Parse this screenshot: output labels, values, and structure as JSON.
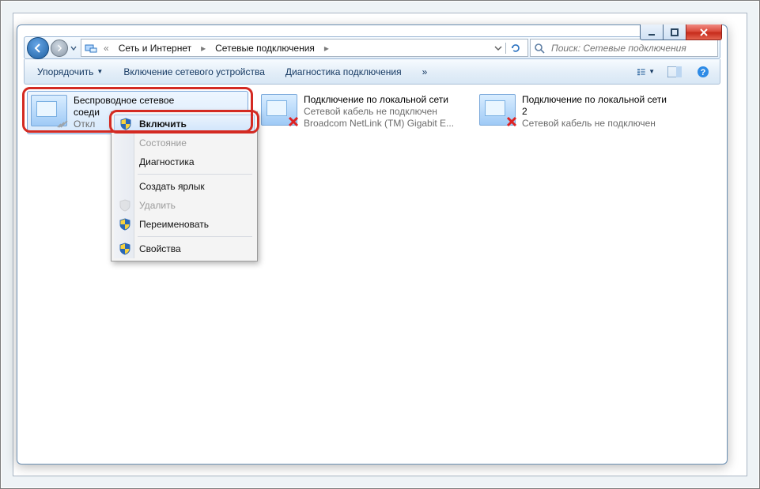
{
  "breadcrumb": {
    "prefix": "«",
    "seg1": "Сеть и Интернет",
    "seg2": "Сетевые подключения"
  },
  "search": {
    "placeholder": "Поиск: Сетевые подключения"
  },
  "toolbar": {
    "organize": "Упорядочить",
    "enableDevice": "Включение сетевого устройства",
    "diagnose": "Диагностика подключения",
    "more": "»"
  },
  "connections": [
    {
      "title": "Беспроводное сетевое",
      "line2": "соеди",
      "line3": "Откл"
    },
    {
      "title": "Подключение по локальной сети",
      "line2": "Сетевой кабель не подключен",
      "line3": "Broadcom NetLink (TM) Gigabit E..."
    },
    {
      "title": "Подключение по локальной сети",
      "line2": "2",
      "line3": "Сетевой кабель не подключен"
    }
  ],
  "contextMenu": {
    "enable": "Включить",
    "status": "Состояние",
    "diag": "Диагностика",
    "shortcut": "Создать ярлык",
    "delete": "Удалить",
    "rename": "Переименовать",
    "props": "Свойства"
  }
}
